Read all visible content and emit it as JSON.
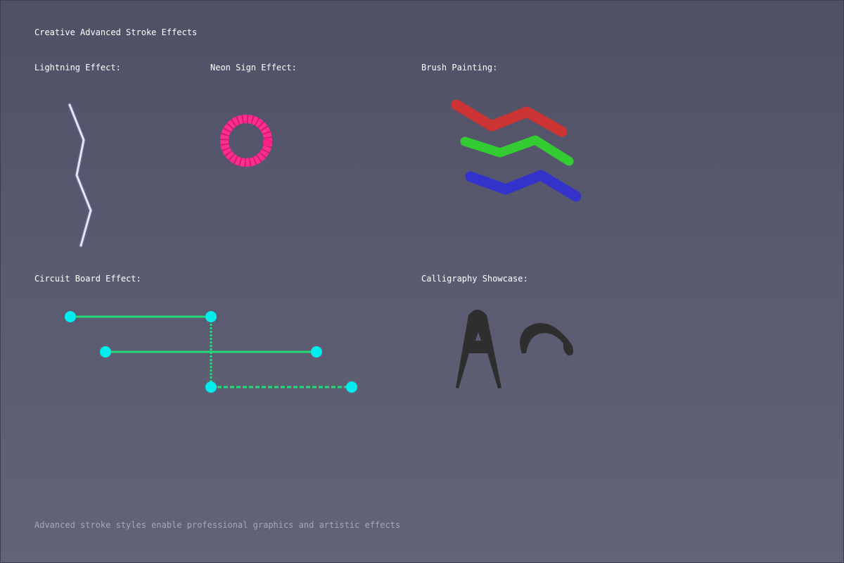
{
  "title": "Creative Advanced Stroke Effects",
  "sections": {
    "lightning": {
      "label": "Lightning Effect:"
    },
    "neon": {
      "label": "Neon Sign Effect:",
      "color": "#ff2d8e"
    },
    "brush": {
      "label": "Brush Painting:",
      "colors": [
        "#cc3333",
        "#33cc33",
        "#3333cc"
      ]
    },
    "circuit": {
      "label": "Circuit Board Effect:",
      "trace_color": "#22dd77",
      "node_color": "#00eeee"
    },
    "calligraphy": {
      "label": "Calligraphy Showcase:",
      "ink_color": "#2e2e2e"
    }
  },
  "footer": "Advanced stroke styles enable professional graphics and artistic effects"
}
